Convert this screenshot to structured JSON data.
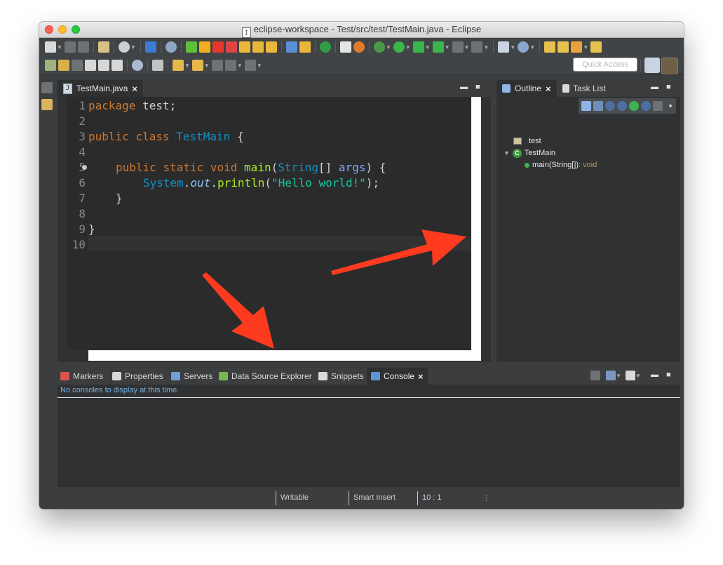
{
  "window": {
    "title": "eclipse-workspace - Test/src/test/TestMain.java - Eclipse",
    "title_file_glyph": "j"
  },
  "toolbar": {
    "quick_access_placeholder": "Quick Access"
  },
  "editor": {
    "tab_label": "TestMain.java",
    "tab_file_glyph": "J",
    "line_numbers": [
      "1",
      "2",
      "3",
      "4",
      "5",
      "6",
      "7",
      "8",
      "9",
      "10"
    ],
    "code": {
      "l1": [
        "package",
        " test;"
      ],
      "l3": [
        "public",
        " ",
        "class",
        " ",
        "TestMain",
        " {"
      ],
      "l5": [
        "public",
        " ",
        "static",
        " ",
        "void",
        " ",
        "main",
        "(",
        "String",
        "[] ",
        "args",
        ") {"
      ],
      "l6": [
        "System",
        ".",
        "out",
        ".",
        "println",
        "(",
        "\"Hello world!\"",
        ");"
      ],
      "l7": "}",
      "l9": "}"
    }
  },
  "outline": {
    "tabs": [
      "Outline",
      "Task List"
    ],
    "tree": {
      "package": "test",
      "class_glyph": "C",
      "class_name": "TestMain",
      "method_name": "main(String[])",
      "method_return": " : void"
    }
  },
  "bottom": {
    "tabs": [
      "Markers",
      "Properties",
      "Servers",
      "Data Source Explorer",
      "Snippets",
      "Console"
    ],
    "console_message": "No consoles to display at this time."
  },
  "status": {
    "writable": "Writable",
    "insert_mode": "Smart Insert",
    "cursor_position": "10 : 1"
  },
  "colors": {
    "arrow": "#ff3b1f",
    "editor_bg": "#2b2b2b",
    "keyword": "#cc7832",
    "type": "#1290c3",
    "string": "#17c6a3"
  }
}
